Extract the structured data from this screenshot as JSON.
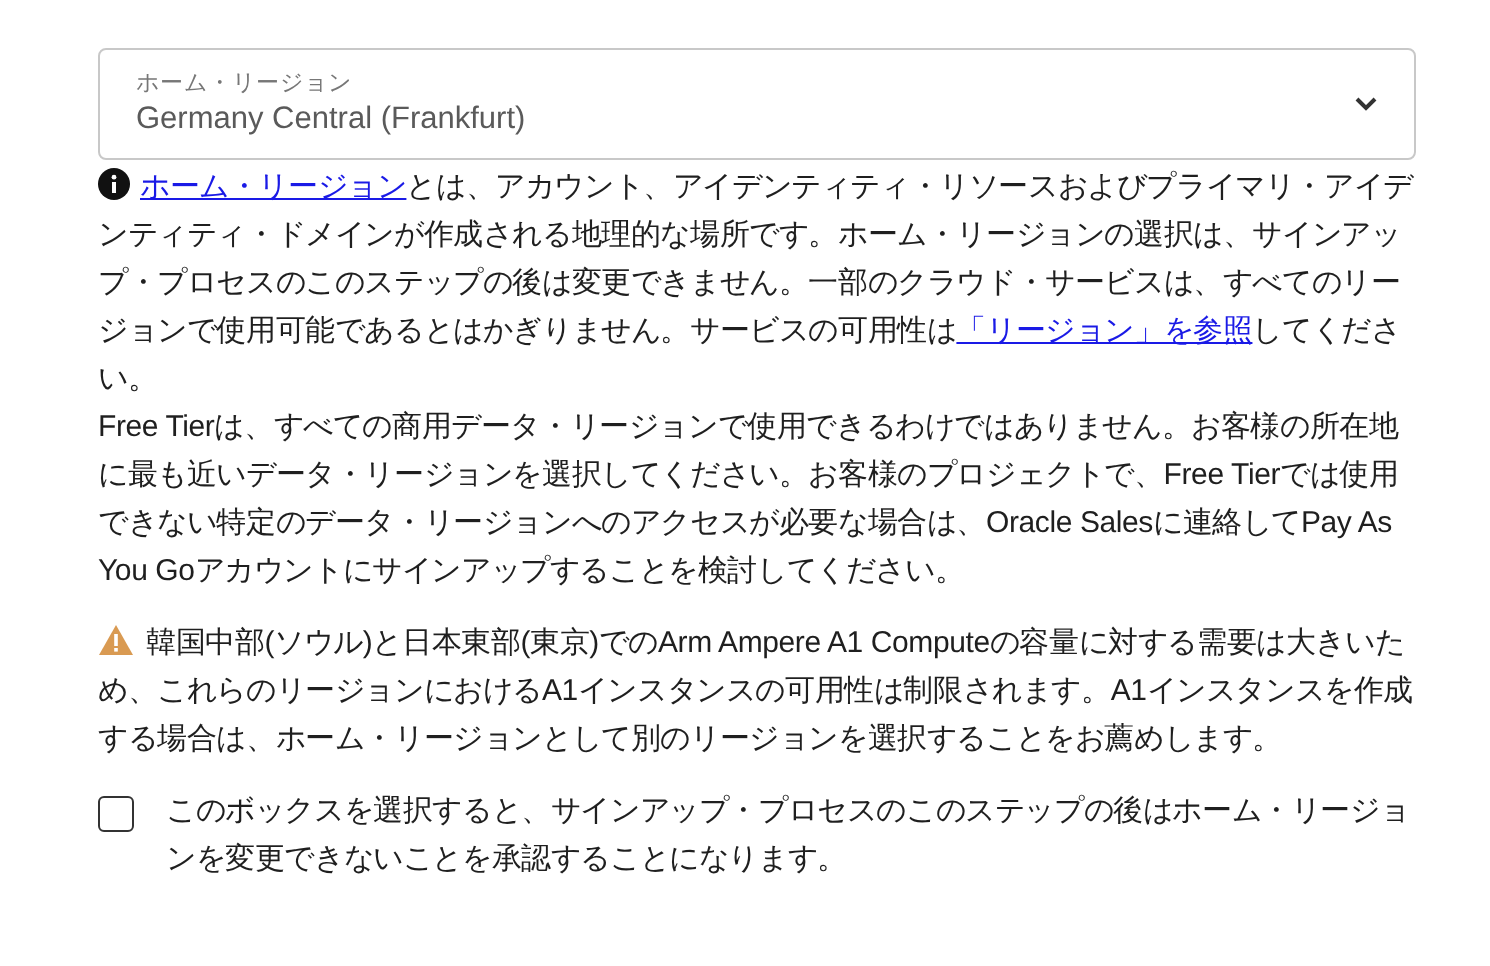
{
  "region_select": {
    "label": "ホーム・リージョン",
    "value": "Germany Central (Frankfurt)"
  },
  "info": [
    {
      "kind": "link",
      "text": "ホーム・リージョン"
    },
    {
      "kind": "text",
      "text": "とは、アカウント、アイデンティティ・リソースおよびプライマリ・アイデンティティ・ドメインが作成される地理的な場所です。ホーム・リージョンの選択は、サインアップ・プロセスのこのステップの後は変更できません。一部のクラウド・サービスは、すべてのリージョンで使用可能であるとはかぎりません。サービスの可用性は"
    },
    {
      "kind": "link",
      "text": "「リージョン」を参照"
    },
    {
      "kind": "text",
      "text": "してください。"
    }
  ],
  "free_tier_note": "Free Tierは、すべての商用データ・リージョンで使用できるわけではありません。お客様の所在地に最も近いデータ・リージョンを選択してください。お客様のプロジェクトで、Free Tierでは使用できない特定のデータ・リージョンへのアクセスが必要な場合は、Oracle Salesに連絡してPay As You Goアカウントにサインアップすることを検討してください。",
  "warning": "韓国中部(ソウル)と日本東部(東京)でのArm Ampere A1 Computeの容量に対する需要は大きいため、これらのリージョンにおけるA1インスタンスの可用性は制限されます。A1インスタンスを作成する場合は、ホーム・リージョンとして別のリージョンを選択することをお薦めします。",
  "acknowledge": {
    "label": "このボックスを選択すると、サインアップ・プロセスのこのステップの後はホーム・リージョンを変更できないことを承認することになります。",
    "checked": false
  }
}
